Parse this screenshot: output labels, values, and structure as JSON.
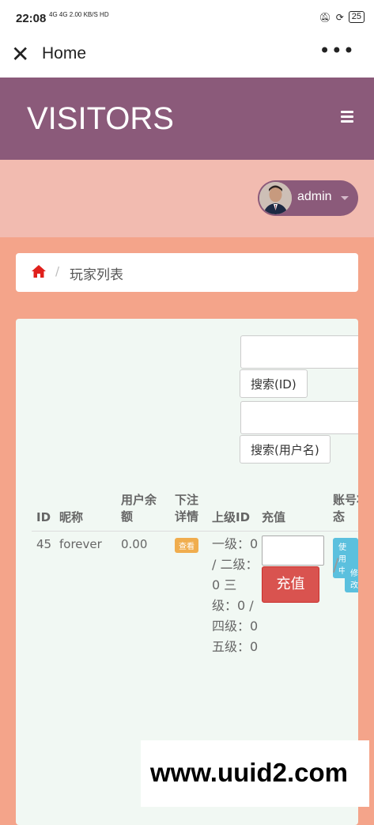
{
  "status_bar": {
    "time": "22:08",
    "network": "4G 4G 2.00 KB/S HD",
    "battery": "25"
  },
  "nav": {
    "title": "Home"
  },
  "header": {
    "brand": "VISITORS"
  },
  "user": {
    "name": "admin"
  },
  "breadcrumb": {
    "current": "玩家列表",
    "separator": "/"
  },
  "search": {
    "id_button": "搜索(ID)",
    "username_button": "搜索(用户名)"
  },
  "table": {
    "headers": {
      "id": "ID",
      "nickname": "昵称",
      "balance": "用户余额",
      "bet_details": "下注详情",
      "parent_id": "上级ID",
      "recharge": "充值",
      "status": "账号状态"
    },
    "rows": [
      {
        "id": "45",
        "nickname": "forever",
        "balance": "0.00",
        "view_label": "查看",
        "levels": "一级：0 / 二级：0 三级：0 / 四级：0 五级：0",
        "recharge_button": "充值",
        "status_label": "使用中",
        "edit_label": "修改"
      }
    ]
  },
  "watermark": "www.uuid2.com",
  "colors": {
    "header": "#8b5a7a",
    "userbar": "#f2bbb0",
    "page": "#f4a48a",
    "panel": "#f1f8f3",
    "danger": "#d9534f",
    "info": "#5bc0de",
    "warning": "#f0ad4e"
  }
}
